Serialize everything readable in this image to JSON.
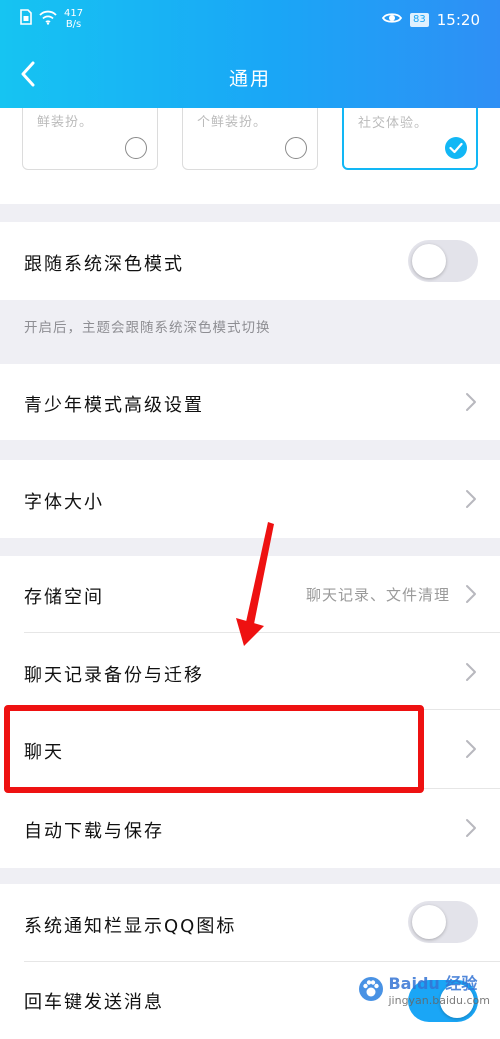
{
  "status_bar": {
    "speed_value": "417",
    "speed_unit": "B/s",
    "battery": "83",
    "time": "15:20"
  },
  "header": {
    "title": "通用"
  },
  "themes": [
    {
      "snippet": "鲜装扮。",
      "selected": false
    },
    {
      "snippet": "个鲜装扮。",
      "selected": false
    },
    {
      "snippet": "社交体验。",
      "selected": true
    }
  ],
  "dark_mode": {
    "label": "跟随系统深色模式",
    "on": false,
    "note": "开启后，主题会跟随系统深色模式切换"
  },
  "youth_mode": {
    "label": "青少年模式高级设置"
  },
  "font_size": {
    "label": "字体大小"
  },
  "storage": {
    "label": "存储空间",
    "value": "聊天记录、文件清理"
  },
  "backup": {
    "label": "聊天记录备份与迁移"
  },
  "chat": {
    "label": "聊天"
  },
  "auto_download": {
    "label": "自动下载与保存"
  },
  "qq_icon": {
    "label": "系统通知栏显示QQ图标",
    "on": false
  },
  "enter_send": {
    "label": "回车键发送消息",
    "on": true
  },
  "watermark": {
    "brand": "Baidu 经验",
    "url": "jingyan.baidu.com"
  },
  "colors": {
    "accent": "#12b7f5",
    "highlight": "#ee1111",
    "header_start": "#16c4f2",
    "header_end": "#2f8ff5"
  }
}
